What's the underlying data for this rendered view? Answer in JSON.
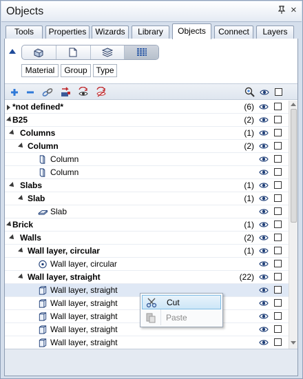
{
  "window": {
    "title": "Objects",
    "pin_glyph": "⇩",
    "close_glyph": "×"
  },
  "tabs": [
    {
      "label": "Tools"
    },
    {
      "label": "Properties"
    },
    {
      "label": "Wizards"
    },
    {
      "label": "Library"
    },
    {
      "label": "Objects",
      "active": true
    },
    {
      "label": "Connect"
    },
    {
      "label": "Layers"
    }
  ],
  "view_buttons": [
    "objects-3d-icon",
    "document-icon",
    "layers-icon",
    "grid-icon"
  ],
  "filters": {
    "material": "Material",
    "group": "Group",
    "type": "Type"
  },
  "toolbar_icons": [
    "expand-all-icon",
    "collapse-all-icon",
    "link-icon",
    "transfer-icon",
    "visibility-on-icon",
    "visibility-off-icon",
    "zoom-icon",
    "eye-column-icon",
    "checkbox-column-icon"
  ],
  "tree": {
    "rows": [
      {
        "label": "*not defined*",
        "count": "(6)",
        "level": 0,
        "bold": true,
        "expander": "right"
      },
      {
        "label": "B25",
        "count": "(2)",
        "level": 0,
        "bold": true,
        "expander": "down"
      },
      {
        "label": "Columns",
        "count": "(1)",
        "level": 1,
        "bold": true,
        "expander": "down"
      },
      {
        "label": "Column",
        "count": "(2)",
        "level": 2,
        "bold": true,
        "expander": "down"
      },
      {
        "label": "Column",
        "count": "",
        "level": 3,
        "bold": false,
        "icon": "column-icon"
      },
      {
        "label": "Column",
        "count": "",
        "level": 3,
        "bold": false,
        "icon": "column-icon"
      },
      {
        "label": "Slabs",
        "count": "(1)",
        "level": 1,
        "bold": true,
        "expander": "down"
      },
      {
        "label": "Slab",
        "count": "(1)",
        "level": 2,
        "bold": true,
        "expander": "down"
      },
      {
        "label": "Slab",
        "count": "",
        "level": 3,
        "bold": false,
        "icon": "slab-icon"
      },
      {
        "label": "Brick",
        "count": "(1)",
        "level": 0,
        "bold": true,
        "expander": "down"
      },
      {
        "label": "Walls",
        "count": "(2)",
        "level": 1,
        "bold": true,
        "expander": "down"
      },
      {
        "label": "Wall layer, circular",
        "count": "(1)",
        "level": 2,
        "bold": true,
        "expander": "down"
      },
      {
        "label": "Wall layer, circular",
        "count": "",
        "level": 3,
        "bold": false,
        "icon": "circular-wall-icon"
      },
      {
        "label": "Wall layer, straight",
        "count": "(22)",
        "level": 2,
        "bold": true,
        "expander": "down"
      },
      {
        "label": "Wall layer, straight",
        "count": "",
        "level": 3,
        "bold": false,
        "icon": "wall-icon",
        "selected": true
      },
      {
        "label": "Wall layer, straight",
        "count": "",
        "level": 3,
        "bold": false,
        "icon": "wall-icon"
      },
      {
        "label": "Wall layer, straight",
        "count": "",
        "level": 3,
        "bold": false,
        "icon": "wall-icon"
      },
      {
        "label": "Wall layer, straight",
        "count": "",
        "level": 3,
        "bold": false,
        "icon": "wall-icon"
      },
      {
        "label": "Wall layer, straight",
        "count": "",
        "level": 3,
        "bold": false,
        "icon": "wall-icon"
      }
    ]
  },
  "context_menu": {
    "items": [
      {
        "label": "Cut",
        "icon": "scissors-icon",
        "highlighted": true,
        "enabled": true
      },
      {
        "label": "Paste",
        "icon": "paste-icon",
        "highlighted": false,
        "enabled": false
      }
    ]
  },
  "colors": {
    "accent_blue": "#1f5bb8",
    "selection": "#dfe8f5",
    "menu_highlight": "#cde6f7"
  }
}
